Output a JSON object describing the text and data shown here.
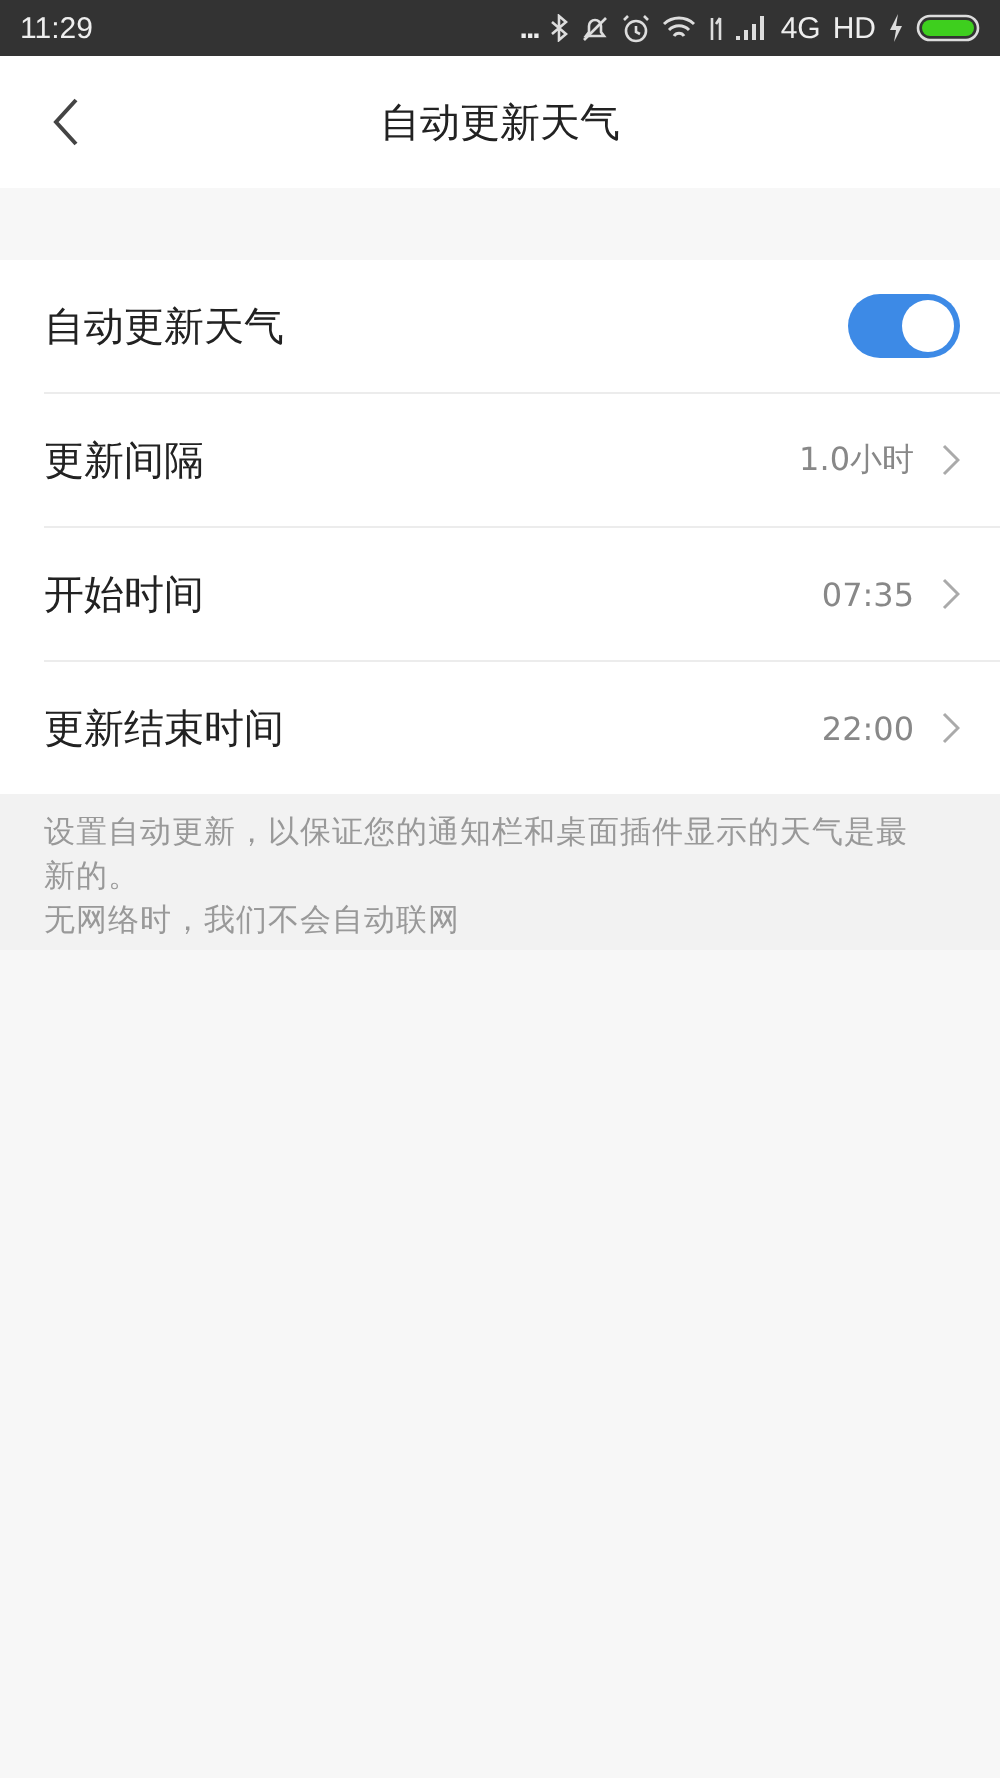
{
  "status_bar": {
    "time": "11:29",
    "dots": "...",
    "network": "4G",
    "hd": "HD"
  },
  "header": {
    "title": "自动更新天气"
  },
  "rows": [
    {
      "kind": "toggle",
      "label": "自动更新天气",
      "on": true
    },
    {
      "kind": "value",
      "label": "更新间隔",
      "value": "1.0小时"
    },
    {
      "kind": "value",
      "label": "开始时间",
      "value": "07:35"
    },
    {
      "kind": "value",
      "label": "更新结束时间",
      "value": "22:00"
    }
  ],
  "notes": [
    "设置自动更新，以保证您的通知栏和桌面插件显示的天气是最新的。",
    "无网络时，我们不会自动联网"
  ]
}
